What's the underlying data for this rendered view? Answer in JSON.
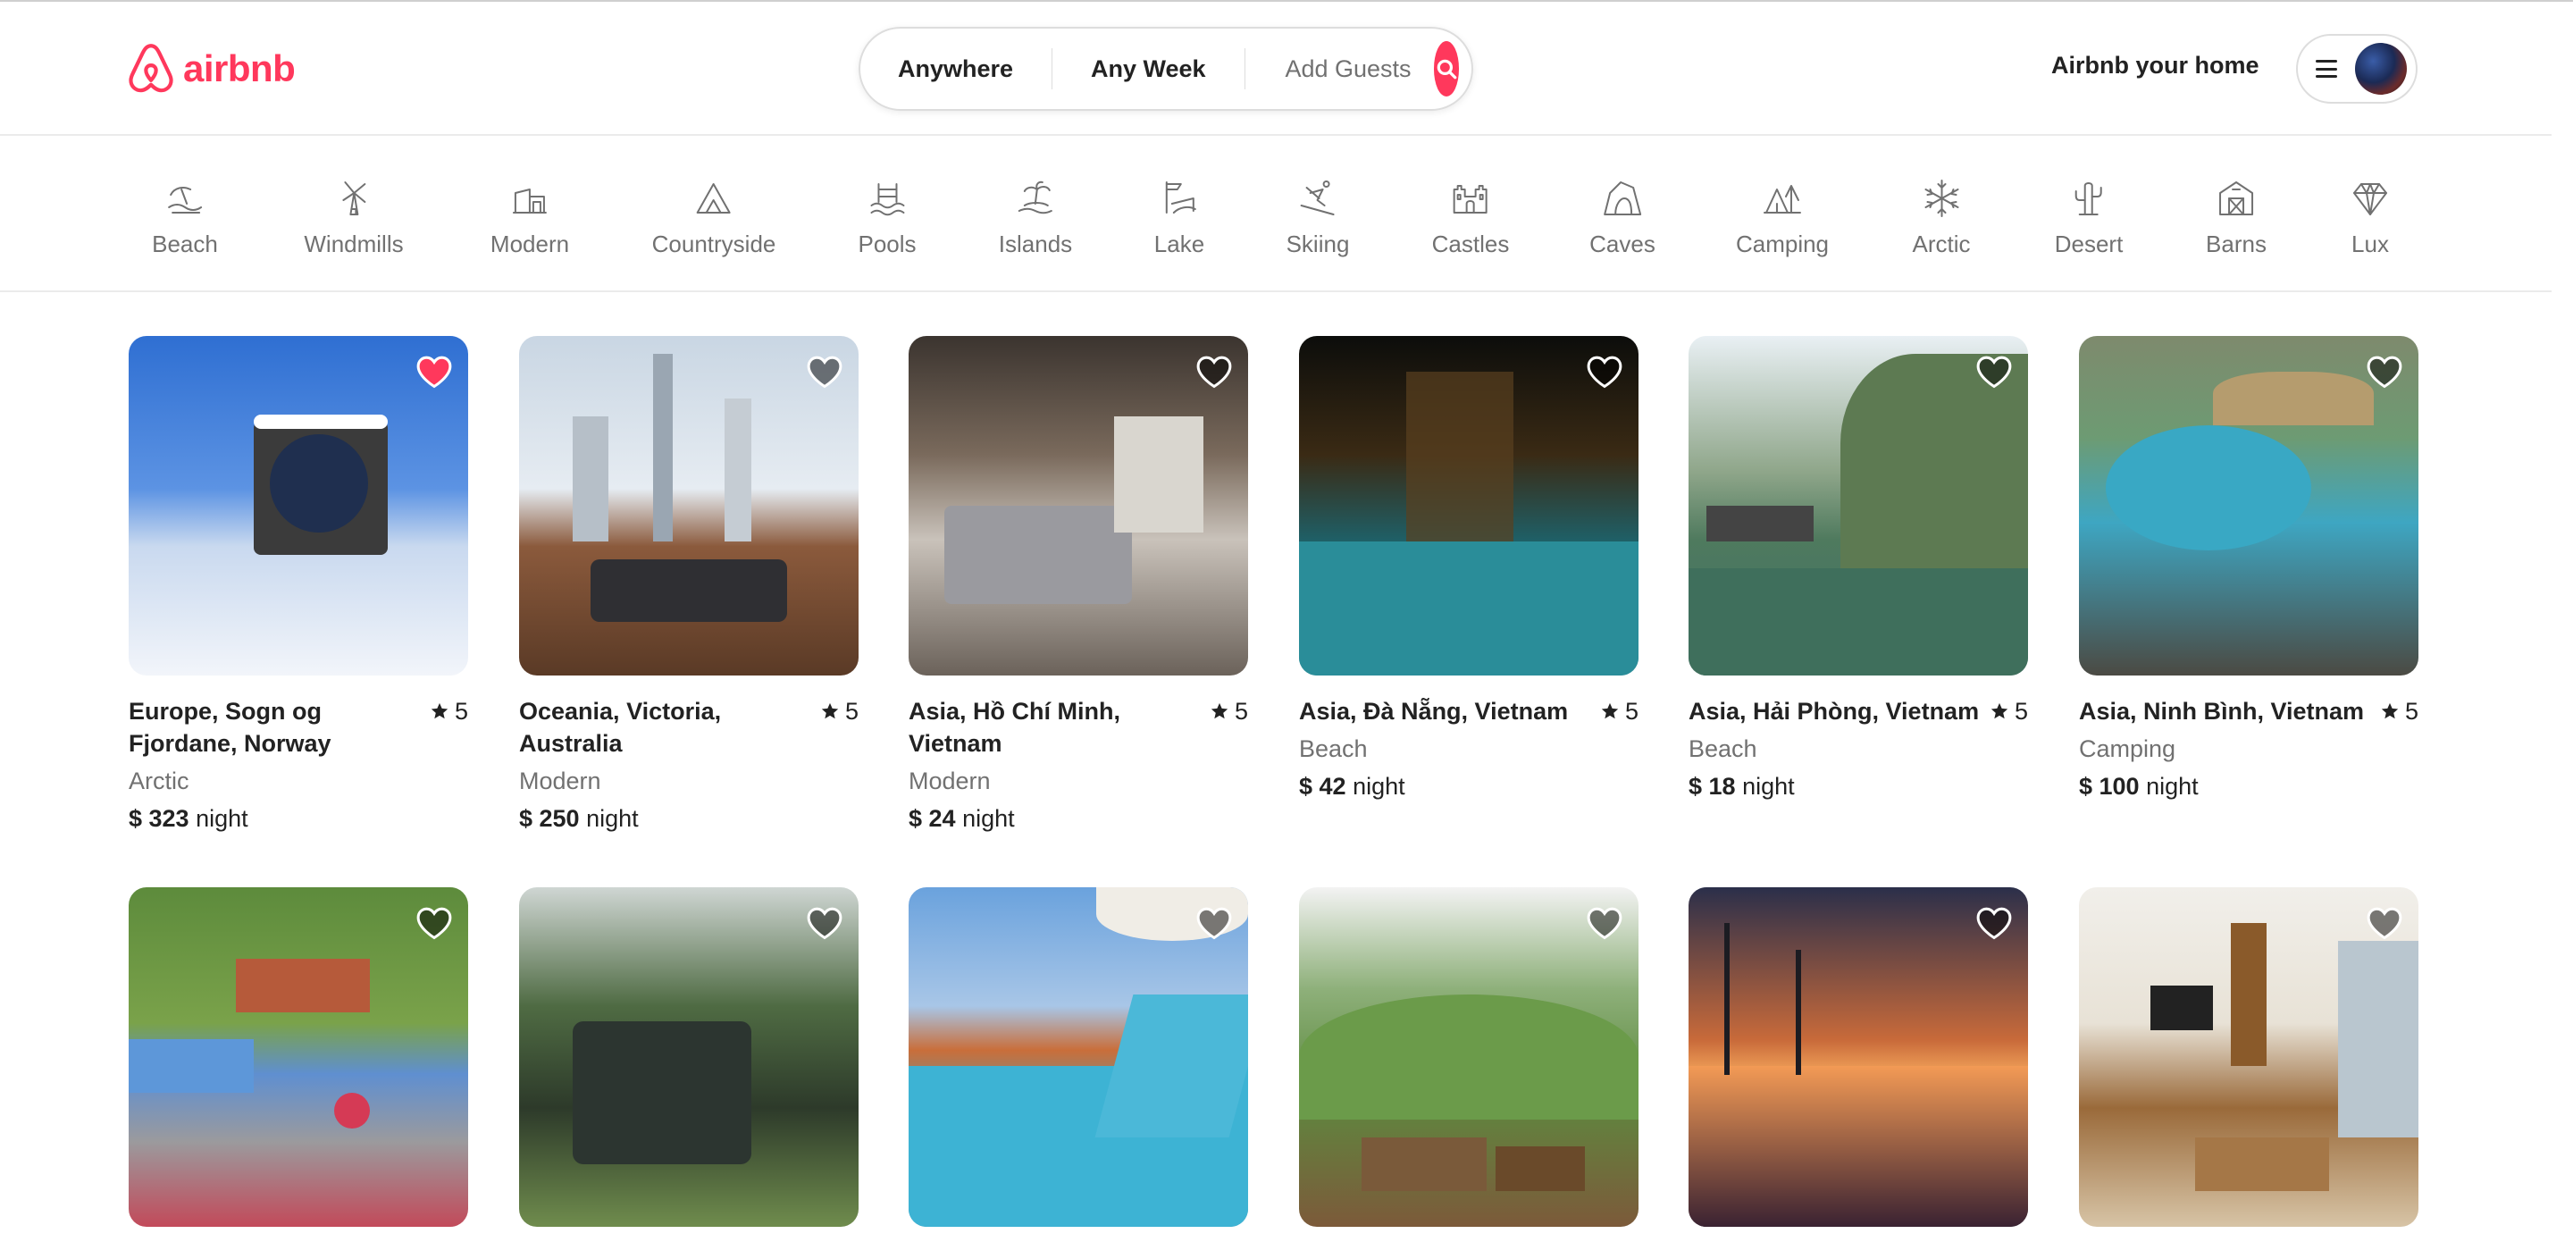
{
  "brand": {
    "name": "airbnb",
    "color": "#ff385c"
  },
  "search": {
    "where": "Anywhere",
    "when": "Any Week",
    "guests": "Add Guests",
    "icon": "search-icon"
  },
  "header": {
    "host_link": "Airbnb your home",
    "menu_icon": "hamburger-icon",
    "avatar": "user-avatar"
  },
  "categories": [
    {
      "label": "Beach",
      "icon": "beach-icon"
    },
    {
      "label": "Windmills",
      "icon": "windmill-icon"
    },
    {
      "label": "Modern",
      "icon": "modern-house-icon"
    },
    {
      "label": "Countryside",
      "icon": "countryside-icon"
    },
    {
      "label": "Pools",
      "icon": "pool-icon"
    },
    {
      "label": "Islands",
      "icon": "island-icon"
    },
    {
      "label": "Lake",
      "icon": "lake-icon"
    },
    {
      "label": "Skiing",
      "icon": "skiing-icon"
    },
    {
      "label": "Castles",
      "icon": "castle-icon"
    },
    {
      "label": "Caves",
      "icon": "cave-icon"
    },
    {
      "label": "Camping",
      "icon": "camping-icon"
    },
    {
      "label": "Arctic",
      "icon": "snowflake-icon"
    },
    {
      "label": "Desert",
      "icon": "cactus-icon"
    },
    {
      "label": "Barns",
      "icon": "barn-icon"
    },
    {
      "label": "Lux",
      "icon": "diamond-icon"
    }
  ],
  "listings": [
    {
      "location": "Europe, Sogn og Fjordane, Norway",
      "rating": "5",
      "category": "Arctic",
      "price": "$ 323",
      "unit": "night",
      "favorited": true
    },
    {
      "location": "Oceania, Victoria, Australia",
      "rating": "5",
      "category": "Modern",
      "price": "$ 250",
      "unit": "night",
      "favorited": false
    },
    {
      "location": "Asia, Hồ Chí Minh, Vietnam",
      "rating": "5",
      "category": "Modern",
      "price": "$ 24",
      "unit": "night",
      "favorited": false
    },
    {
      "location": "Asia, Đà Nẵng, Vietnam",
      "rating": "5",
      "category": "Beach",
      "price": "$ 42",
      "unit": "night",
      "favorited": false
    },
    {
      "location": "Asia, Hải Phòng, Vietnam",
      "rating": "5",
      "category": "Beach",
      "price": "$ 18",
      "unit": "night",
      "favorited": false
    },
    {
      "location": "Asia, Ninh Bình, Vietnam",
      "rating": "5",
      "category": "Camping",
      "price": "$ 100",
      "unit": "night",
      "favorited": false
    },
    {
      "favorited": false
    },
    {
      "favorited": false
    },
    {
      "favorited": false
    },
    {
      "favorited": false
    },
    {
      "favorited": false
    },
    {
      "favorited": false
    }
  ],
  "colors": {
    "accent": "#ff385c",
    "text": "#222222",
    "muted": "#717171",
    "border": "#dddddd"
  }
}
